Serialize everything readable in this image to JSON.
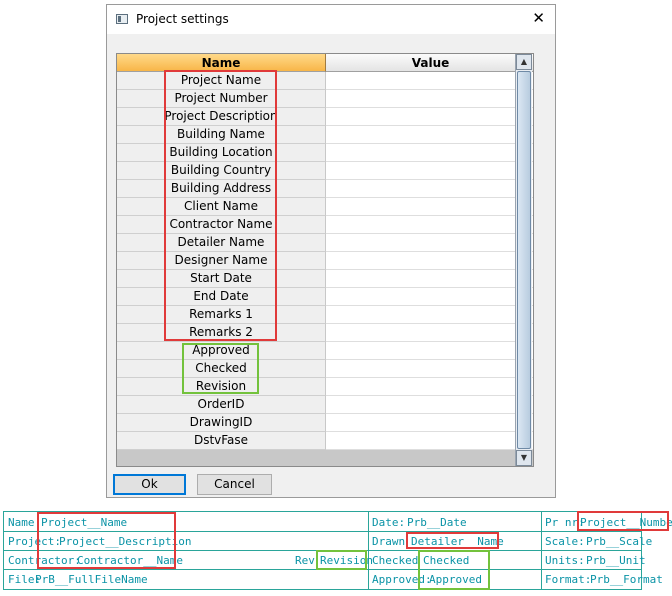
{
  "dialog": {
    "title": "Project settings",
    "close_glyph": "✕",
    "columns": {
      "name": "Name",
      "value": "Value"
    },
    "rows": [
      {
        "name": "Project Name",
        "value": ""
      },
      {
        "name": "Project Number",
        "value": ""
      },
      {
        "name": "Project Description",
        "value": ""
      },
      {
        "name": "Building Name",
        "value": ""
      },
      {
        "name": "Building Location",
        "value": ""
      },
      {
        "name": "Building Country",
        "value": ""
      },
      {
        "name": "Building Address",
        "value": ""
      },
      {
        "name": "Client Name",
        "value": ""
      },
      {
        "name": "Contractor Name",
        "value": ""
      },
      {
        "name": "Detailer Name",
        "value": ""
      },
      {
        "name": "Designer Name",
        "value": ""
      },
      {
        "name": "Start Date",
        "value": ""
      },
      {
        "name": "End Date",
        "value": ""
      },
      {
        "name": "Remarks 1",
        "value": ""
      },
      {
        "name": "Remarks 2",
        "value": ""
      },
      {
        "name": "Approved",
        "value": ""
      },
      {
        "name": "Checked",
        "value": ""
      },
      {
        "name": "Revision",
        "value": ""
      },
      {
        "name": "OrderID",
        "value": ""
      },
      {
        "name": "DrawingID",
        "value": ""
      },
      {
        "name": "DstvFase",
        "value": ""
      }
    ],
    "ok_label": "Ok",
    "cancel_label": "Cancel"
  },
  "title_block": {
    "r1": {
      "name_label": "Name",
      "name_value": "Project__Name",
      "date_label": "Date:",
      "date_value": "Prb__Date",
      "prnr_label": "Pr nr:",
      "prnr_value": "Project__Number"
    },
    "r2": {
      "project_label": "Project:",
      "project_value": "Project__Description",
      "drawn_label": "Drawn",
      "drawn_value": "Detailer__Name",
      "scale_label": "Scale:",
      "scale_value": "Prb__Scale"
    },
    "r3": {
      "contractor_label": "Contractor:",
      "contractor_value": "Contractor__Name",
      "rev_label": "Rev",
      "rev_value": "Revision",
      "checked_label": "Checked",
      "checked_value": "Checked",
      "units_label": "Units:",
      "units_value": "Prb__Unit"
    },
    "r4": {
      "file_label": "File:",
      "file_value": "PrB__FullFileName",
      "approved_label": "Approved:",
      "approved_value": "Approved",
      "format_label": "Format:",
      "format_value": "Prb__Format"
    }
  },
  "colors": {
    "header_accent": "#f8b648",
    "panel_line": "#2aa59a",
    "panel_text": "#0a93a6",
    "highlight_red": "#e03a3a",
    "highlight_green": "#73c23c"
  }
}
